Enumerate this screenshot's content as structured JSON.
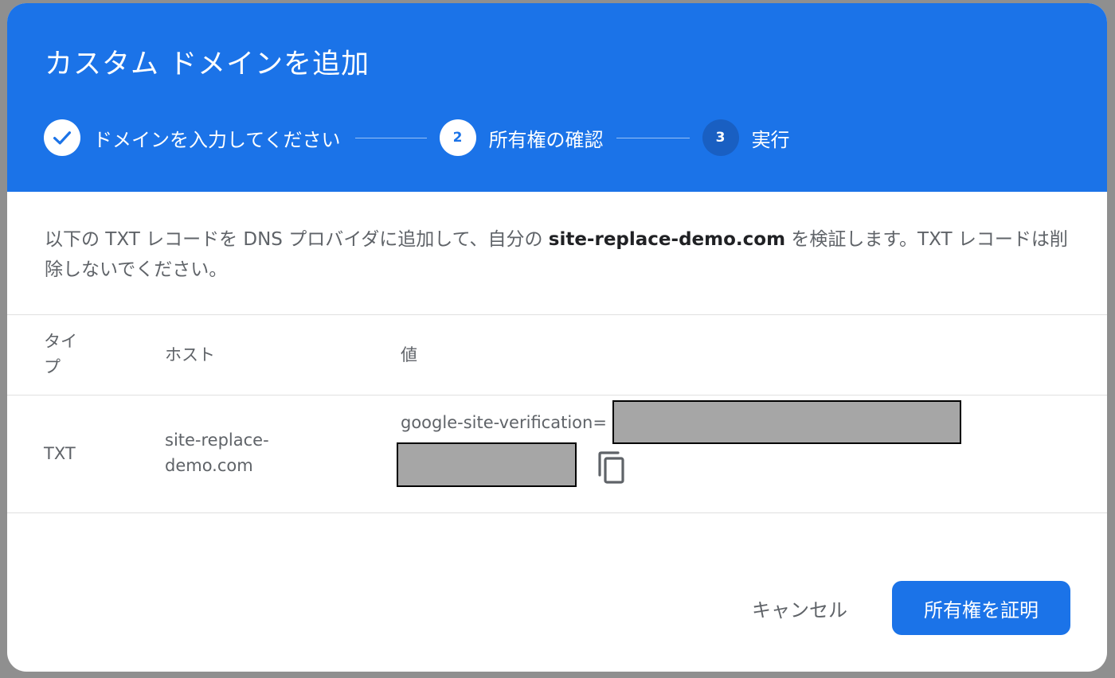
{
  "dialog": {
    "title": "カスタム ドメインを追加"
  },
  "stepper": {
    "steps": [
      {
        "number": "",
        "label": "ドメインを入力してください",
        "state": "completed",
        "icon": "check-icon"
      },
      {
        "number": "2",
        "label": "所有権の確認",
        "state": "active"
      },
      {
        "number": "3",
        "label": "実行",
        "state": "pending"
      }
    ]
  },
  "description": {
    "before": "以下の TXT レコードを DNS プロバイダに追加して、自分の ",
    "domain": "site-replace-demo.com",
    "after": " を検証します。TXT レコードは削除しないでください。"
  },
  "table": {
    "headers": [
      "タイプ",
      "ホスト",
      "値"
    ],
    "rows": [
      {
        "type": "TXT",
        "host": "site-replace-demo.com",
        "value_prefix": "google-site-verification=",
        "value_redacted": true
      }
    ]
  },
  "icons": {
    "copy": "copy-icon"
  },
  "actions": {
    "cancel_label": "キャンセル",
    "confirm_label": "所有権を証明"
  },
  "colors": {
    "header_bg": "#1b73e8",
    "primary_button": "#1b73e8",
    "redaction": "#a6a6a6"
  }
}
